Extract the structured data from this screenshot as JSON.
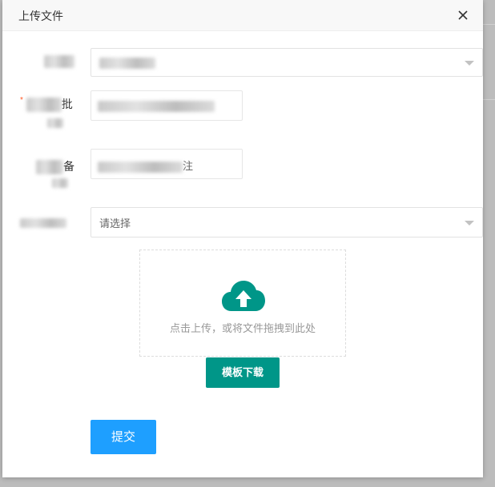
{
  "dialog": {
    "title": "上传文件",
    "close_icon": "close-icon"
  },
  "form": {
    "field1": {
      "label_visible_fragment": "",
      "select_value": ""
    },
    "field2": {
      "label_visible_fragment": "批",
      "input_value": ""
    },
    "field3": {
      "label_visible_fragment": "备",
      "input_value_fragment": "注"
    },
    "field4": {
      "label_visible_fragment": "",
      "select_placeholder": "请选择"
    }
  },
  "upload": {
    "icon": "cloud-upload-icon",
    "hint": "点击上传，或将文件拖拽到此处",
    "template_button": "模板下载"
  },
  "actions": {
    "submit_label": "提交"
  },
  "colors": {
    "primary_green": "#009688",
    "primary_blue": "#1e9fff"
  }
}
